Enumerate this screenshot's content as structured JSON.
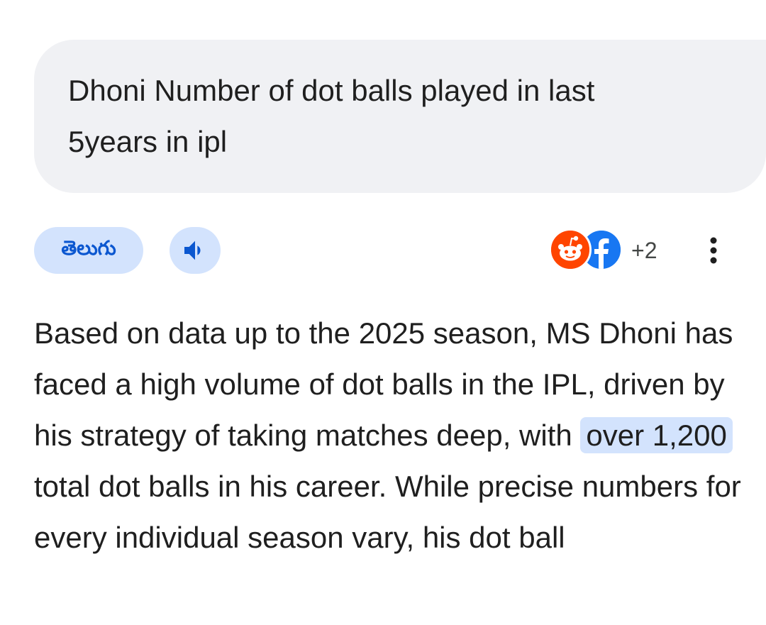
{
  "query": {
    "line1": "Dhoni Number of dot balls played in last",
    "line2": "5years in ipl"
  },
  "actions": {
    "language_label": "తెలుగు",
    "speaker_icon": "volume-up-icon",
    "sources": [
      "reddit-icon",
      "facebook-icon"
    ],
    "more_sources_label": "+2",
    "more_icon": "more-vert-icon"
  },
  "answer": {
    "before_highlight": "Based on data up to the 2025 season, MS Dhoni has faced a high volume of dot balls in the IPL, driven by his strategy of taking matches deep, with ",
    "highlight": "over 1,200",
    "after_highlight": " total dot balls in his career. While precise numbers for every individual season vary, his dot ball"
  },
  "colors": {
    "bubble_bg": "#f0f1f4",
    "chip_bg": "#d3e3fd",
    "accent": "#0b57d0",
    "reddit": "#ff4500",
    "facebook": "#1877f2"
  }
}
